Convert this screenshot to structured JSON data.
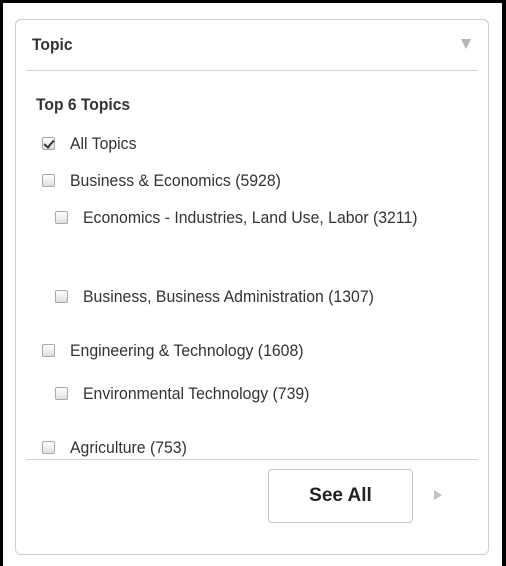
{
  "facet": {
    "title": "Topic",
    "toggle_icon": "triangle-down-icon",
    "group_title": "Top 6 Topics",
    "options": [
      {
        "label": "All Topics",
        "checked": true
      },
      {
        "label": "Business & Economics (5928)",
        "checked": false
      },
      {
        "label": "Economics - Industries, Land Use, Labor (3211)",
        "checked": false
      },
      {
        "label": "Business, Business Administration (1307)",
        "checked": false
      },
      {
        "label": "Engineering & Technology (1608)",
        "checked": false
      },
      {
        "label": "Environmental Technology (739)",
        "checked": false
      },
      {
        "label": "Agriculture (753)",
        "checked": false
      }
    ],
    "see_all_label": "See All",
    "next_icon": "triangle-right-icon"
  }
}
